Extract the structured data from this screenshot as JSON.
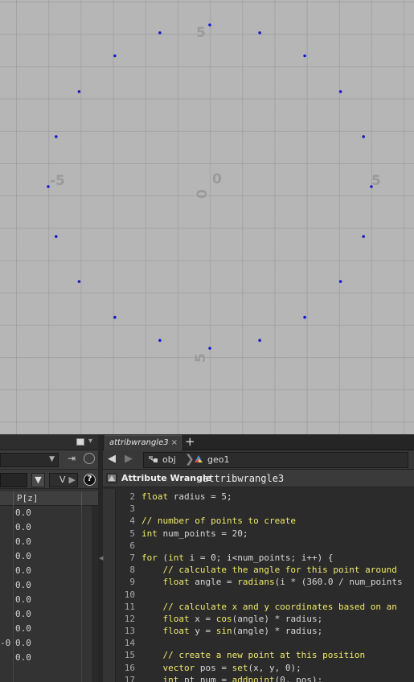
{
  "viewport": {
    "axis_labels": {
      "x_neg": "-5",
      "x_zero": "0",
      "x_pos": "5",
      "y_pos": "5",
      "y_zero": "0",
      "y_neg": "5"
    },
    "point_count": 20,
    "point_color": "#1a1acc",
    "background_color": "#b6b6b6"
  },
  "spreadsheet": {
    "filter_label": "V",
    "column_header": "P[z]",
    "partial_left_value": "-0",
    "rows": [
      "0.0",
      "0.0",
      "0.0",
      "0.0",
      "0.0",
      "0.0",
      "0.0",
      "0.0",
      "0.0",
      "0.0",
      "0.0"
    ]
  },
  "editor": {
    "tab_label": "attribwrangle3",
    "tab_close": "×",
    "new_tab": "+",
    "path": [
      "obj",
      "geo1"
    ],
    "node_type": "Attribute Wrangle",
    "node_name": "attribwrangle3",
    "code_lines": [
      {
        "n": "2",
        "t": "float radius = 5;"
      },
      {
        "n": "3",
        "t": ""
      },
      {
        "n": "4",
        "t": "// number of points to create"
      },
      {
        "n": "5",
        "t": "int num_points = 20;"
      },
      {
        "n": "6",
        "t": ""
      },
      {
        "n": "7",
        "t": "for (int i = 0; i<num_points; i++) {"
      },
      {
        "n": "8",
        "t": "    // calculate the angle for this point around"
      },
      {
        "n": "9",
        "t": "    float angle = radians(i * (360.0 / num_points"
      },
      {
        "n": "10",
        "t": ""
      },
      {
        "n": "11",
        "t": "    // calculate x and y coordinates based on an"
      },
      {
        "n": "12",
        "t": "    float x = cos(angle) * radius;"
      },
      {
        "n": "13",
        "t": "    float y = sin(angle) * radius;"
      },
      {
        "n": "14",
        "t": ""
      },
      {
        "n": "15",
        "t": "    // create a new point at this position"
      },
      {
        "n": "16",
        "t": "    vector pos = set(x, y, 0);"
      },
      {
        "n": "17",
        "t": "    int pt_num = addpoint(0, pos);"
      }
    ]
  },
  "icons": {
    "back": "arrow-left-icon",
    "forward": "arrow-right-icon",
    "help": "help-icon",
    "filter": "funnel-icon",
    "pin": "pin-icon"
  }
}
